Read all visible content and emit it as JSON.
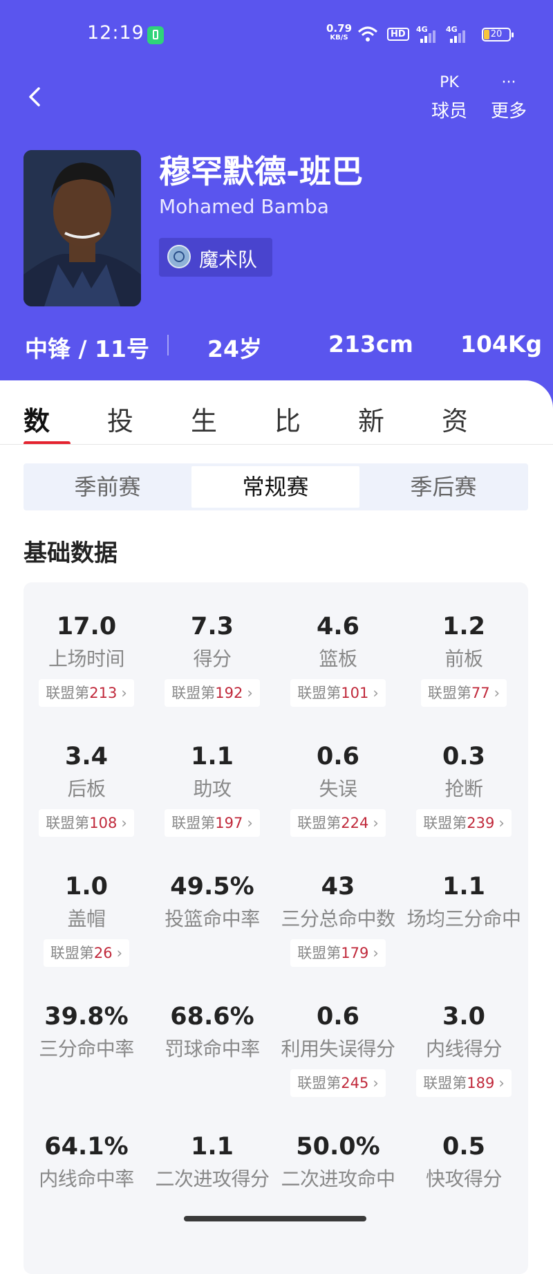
{
  "status_bar": {
    "time": "12:19",
    "net_speed": "0.79",
    "net_unit": "KB/S",
    "hd": "HD",
    "sig1": "4G",
    "sig2": "4G",
    "battery": "20"
  },
  "header": {
    "pk_icon": "PK",
    "pk_label": "球员",
    "more_icon": "···",
    "more_label": "更多",
    "name_cn": "穆罕默德-班巴",
    "name_en": "Mohamed Bamba",
    "team": "魔术队"
  },
  "player_info": {
    "position": "中锋 / 11号",
    "age": "24岁",
    "height": "213cm",
    "weight": "104Kg"
  },
  "tabs": [
    {
      "label": "数"
    },
    {
      "label": "投"
    },
    {
      "label": "生"
    },
    {
      "label": "比"
    },
    {
      "label": "新"
    },
    {
      "label": "资"
    }
  ],
  "segments": [
    {
      "label": "季前赛"
    },
    {
      "label": "常规赛"
    },
    {
      "label": "季后赛"
    }
  ],
  "section_title": "基础数据",
  "rank_prefix": "联盟第",
  "stats": [
    {
      "value": "17.0",
      "label": "上场时间",
      "rank": "213"
    },
    {
      "value": "7.3",
      "label": "得分",
      "rank": "192"
    },
    {
      "value": "4.6",
      "label": "篮板",
      "rank": "101"
    },
    {
      "value": "1.2",
      "label": "前板",
      "rank": "77"
    },
    {
      "value": "3.4",
      "label": "后板",
      "rank": "108"
    },
    {
      "value": "1.1",
      "label": "助攻",
      "rank": "197"
    },
    {
      "value": "0.6",
      "label": "失误",
      "rank": "224"
    },
    {
      "value": "0.3",
      "label": "抢断",
      "rank": "239"
    },
    {
      "value": "1.0",
      "label": "盖帽",
      "rank": "26"
    },
    {
      "value": "49.5%",
      "label": "投篮命中率",
      "rank": ""
    },
    {
      "value": "43",
      "label": "三分总命中数",
      "rank": "179"
    },
    {
      "value": "1.1",
      "label": "场均三分命中",
      "rank": ""
    },
    {
      "value": "39.8%",
      "label": "三分命中率",
      "rank": ""
    },
    {
      "value": "68.6%",
      "label": "罚球命中率",
      "rank": ""
    },
    {
      "value": "0.6",
      "label": "利用失误得分",
      "rank": "245"
    },
    {
      "value": "3.0",
      "label": "内线得分",
      "rank": "189"
    },
    {
      "value": "64.1%",
      "label": "内线命中率",
      "rank": ""
    },
    {
      "value": "1.1",
      "label": "二次进攻得分",
      "rank": ""
    },
    {
      "value": "50.0%",
      "label": "二次进攻命中",
      "rank": ""
    },
    {
      "value": "0.5",
      "label": "快攻得分",
      "rank": ""
    }
  ],
  "colors": {
    "header_bg": "#5a55ee",
    "accent_red": "#e4232f",
    "rank_red": "#c0283a"
  }
}
